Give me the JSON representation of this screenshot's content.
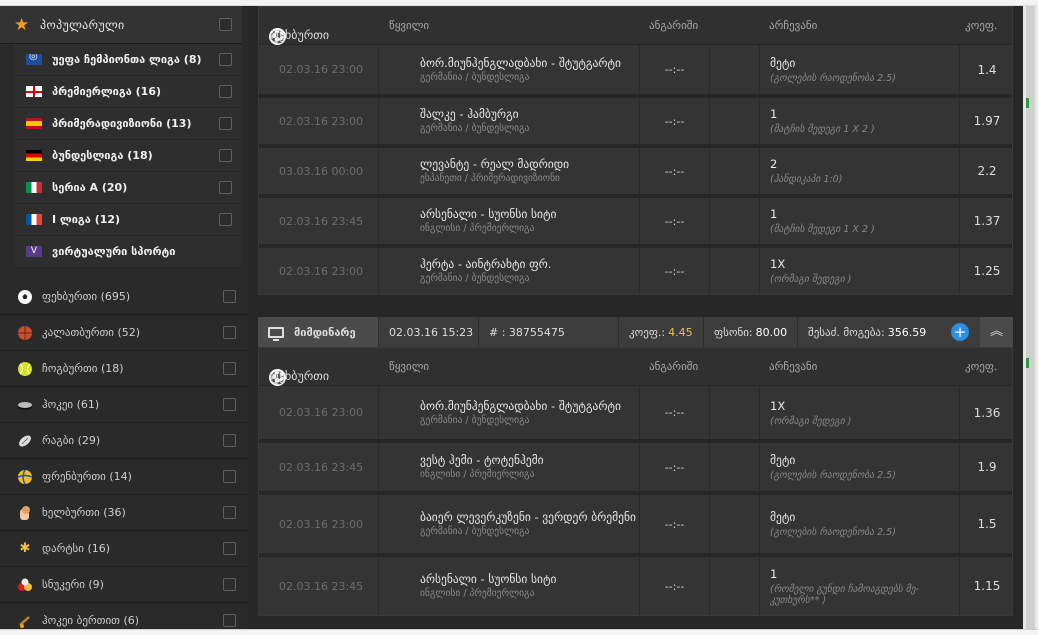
{
  "sidebar": {
    "favorites_title": "პოპულარული",
    "leagues": [
      {
        "label": "უეფა ჩემპიონთა ლიგა (8)",
        "flag": "cl-icon"
      },
      {
        "label": "პრემიერლიგა (16)",
        "flag": "england-flag-icon"
      },
      {
        "label": "პრიმერადივიზიონი (13)",
        "flag": "spain-flag-icon"
      },
      {
        "label": "ბუნდესლიგა (18)",
        "flag": "germany-flag-icon"
      },
      {
        "label": "სერია A (20)",
        "flag": "italy-flag-icon"
      },
      {
        "label": "I ლიგა (12)",
        "flag": "france-flag-icon"
      },
      {
        "label": "ვირტუალური სპორტი",
        "flag": "virtual-icon"
      }
    ],
    "sports": [
      {
        "label": "ფეხბურთი (695)",
        "icon": "soccer-ball-icon"
      },
      {
        "label": "კალათბურთი (52)",
        "icon": "basketball-icon"
      },
      {
        "label": "ჩოგბურთი (18)",
        "icon": "tennis-ball-icon"
      },
      {
        "label": "ჰოკეი (61)",
        "icon": "hockey-puck-icon"
      },
      {
        "label": "რაგბი (29)",
        "icon": "rugby-ball-icon"
      },
      {
        "label": "ფრენბურთი (14)",
        "icon": "volleyball-icon"
      },
      {
        "label": "ხელბურთი (36)",
        "icon": "handball-icon"
      },
      {
        "label": "დარტსი (16)",
        "icon": "darts-icon"
      },
      {
        "label": "სნუკერი (9)",
        "icon": "snooker-icon"
      },
      {
        "label": "ჰოკეი ბერთით (6)",
        "icon": "field-hockey-icon"
      }
    ]
  },
  "columns": {
    "sport": "ფეხბურთი",
    "event": "წყვილი",
    "result": "ანგარიში",
    "pick": "არჩევანი",
    "odds": "კოეფ."
  },
  "panel1": {
    "rows": [
      {
        "date": "02.03.16 23:00",
        "name": "ბორ.მიუნჰენგლადბახი - შტუტგარტი",
        "league": "გერმანია / ბუნდესლიგა",
        "result": "--:--",
        "pick": "მეტი",
        "desc": "(გოლების რაოდენობა 2.5)",
        "odds": "1.4"
      },
      {
        "date": "02.03.16 23:00",
        "name": "შალკე - ჰამბურგი",
        "league": "გერმანია / ბუნდესლიგა",
        "result": "--:--",
        "pick": "1",
        "desc": "(მატჩის შედეგი 1 X 2 )",
        "odds": "1.97"
      },
      {
        "date": "03.03.16 00:00",
        "name": "ლევანტე - რეალ მადრიდი",
        "league": "ესპანეთი / პრიმერადივიზიონი",
        "result": "--:--",
        "pick": "2",
        "desc": "(ჰანდიკაპი 1:0)",
        "odds": "2.2"
      },
      {
        "date": "02.03.16 23:45",
        "name": "არსენალი - სუონსი სიტი",
        "league": "ინგლისი / პრემიერლიგა",
        "result": "--:--",
        "pick": "1",
        "desc": "(მატჩის შედეგი 1 X 2 )",
        "odds": "1.37"
      },
      {
        "date": "02.03.16 23:00",
        "name": "ჰერტა - აინტრახტი ფრ.",
        "league": "გერმანია / ბუნდესლიგა",
        "result": "--:--",
        "pick": "1X",
        "desc": "(ორმაგი შედეგი )",
        "odds": "1.25"
      }
    ]
  },
  "betbar": {
    "status": "მიმდინარე",
    "datetime": "02.03.16 15:23",
    "ticket": "# : 38755475",
    "odds_label": "კოეფ.:",
    "odds_value": "4.45",
    "stake_label": "ფსონი:",
    "stake_value": "80.00",
    "win_label": "შესაძ. მოგება:",
    "win_value": "356.59"
  },
  "panel2": {
    "rows": [
      {
        "date": "02.03.16 23:00",
        "name": "ბორ.მიუნჰენგლადბახი - შტუტგარტი",
        "league": "გერმანია / ბუნდესლიგა",
        "result": "--:--",
        "pick": "1X",
        "desc": "(ორმაგი შედეგი )",
        "odds": "1.36"
      },
      {
        "date": "02.03.16 23:45",
        "name": "ვესტ ჰემი - ტოტენჰემი",
        "league": "ინგლისი / პრემიერლიგა",
        "result": "--:--",
        "pick": "მეტი",
        "desc": "(გოლების რაოდენობა 2.5)",
        "odds": "1.9"
      },
      {
        "date": "02.03.16 23:00",
        "name": "ბაიერ ლევერკუზენი - ვერდერ ბრემენი",
        "league": "გერმანია / ბუნდესლიგა",
        "result": "--:--",
        "pick": "მეტი",
        "desc": "(გოლების რაოდენობა 2.5)",
        "odds": "1.5"
      },
      {
        "date": "02.03.16 23:45",
        "name": "არსენალი - სუონსი სიტი",
        "league": "ინგლისი / პრემიერლიგა",
        "result": "--:--",
        "pick": "1",
        "desc": "(რომელი გუნდი ჩამოაგდებს მე-კუთხურს** )",
        "odds": "1.15"
      }
    ]
  },
  "colors": {
    "accent_star": "#f0a020",
    "odds_yellow": "#f0c040",
    "plus_blue": "#2b8ee0"
  }
}
